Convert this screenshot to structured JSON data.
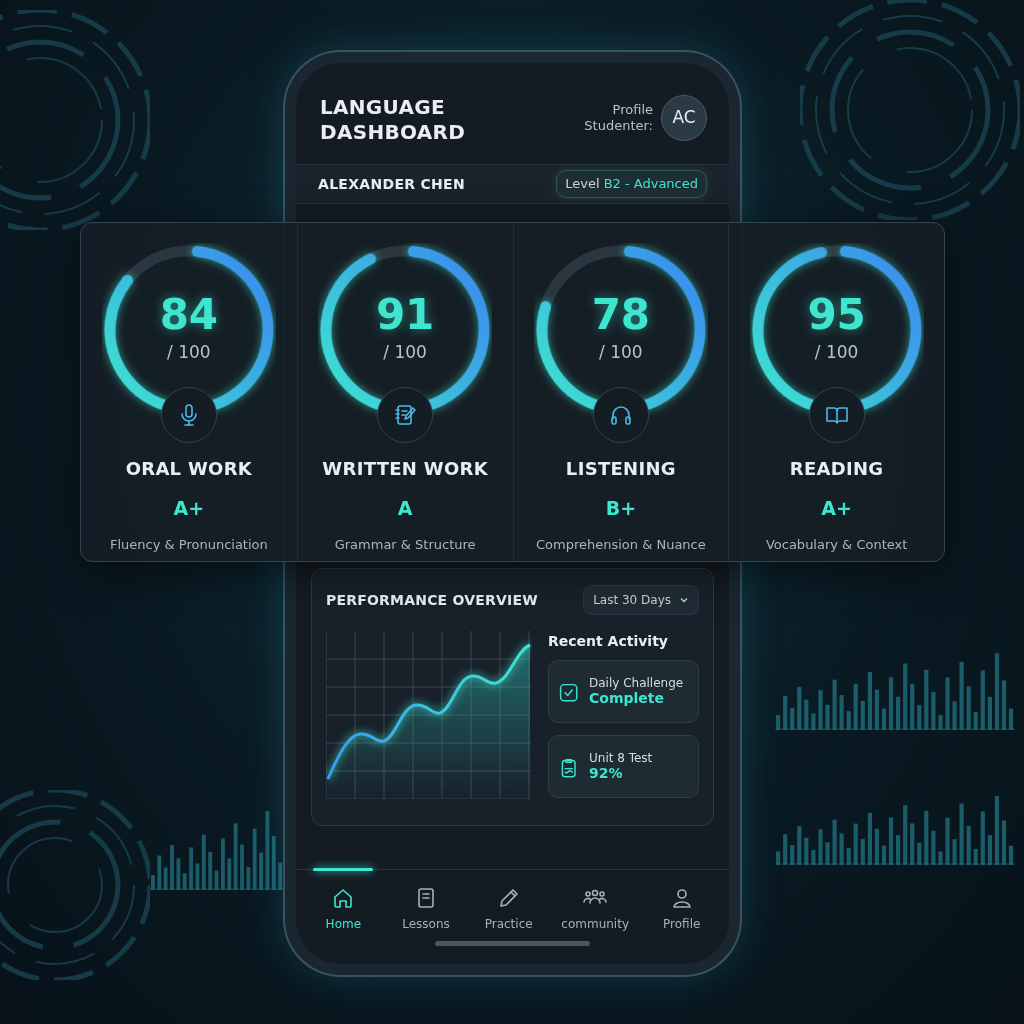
{
  "header": {
    "title": "LANGUAGE DASHBOARD",
    "profile_label": "Profile Studenter:",
    "avatar_initials": "AC"
  },
  "student": {
    "name": "ALEXANDER CHEN",
    "level_label": "Level",
    "level_value": "B2 - Advanced"
  },
  "scores": [
    {
      "kind": "microphone",
      "score": "84",
      "out_of": "/ 100",
      "level": 0.84,
      "name": "ORAL WORK",
      "grade": "A+",
      "description": "Fluency & Pronunciation"
    },
    {
      "kind": "notebook",
      "score": "91",
      "out_of": "/ 100",
      "level": 0.91,
      "name": "WRITTEN WORK",
      "grade": "A",
      "description": "Grammar & Structure"
    },
    {
      "kind": "headphones",
      "score": "78",
      "out_of": "/ 100",
      "level": 0.78,
      "name": "LISTENING",
      "grade": "B+",
      "description": "Comprehension & Nuance"
    },
    {
      "kind": "book",
      "score": "95",
      "out_of": "/ 100",
      "level": 0.95,
      "name": "READING",
      "grade": "A+",
      "description": "Vocabulary & Context"
    }
  ],
  "performance": {
    "title": "PERFORMANCE OVERVIEW",
    "range_button": "Last 30 Days",
    "recent_title": "Recent Activity",
    "activities": [
      {
        "kind": "check",
        "title": "Daily Challenge",
        "value": "Complete"
      },
      {
        "kind": "clipboard",
        "title": "Unit 8 Test",
        "value": "92%"
      }
    ]
  },
  "nav": [
    {
      "kind": "home",
      "label": "Home",
      "selected": true
    },
    {
      "kind": "document",
      "label": "Lessons",
      "selected": false
    },
    {
      "kind": "pencil",
      "label": "Practice",
      "selected": false
    },
    {
      "kind": "people",
      "label": "community",
      "selected": false
    },
    {
      "kind": "person",
      "label": "Profile",
      "selected": false
    }
  ]
}
